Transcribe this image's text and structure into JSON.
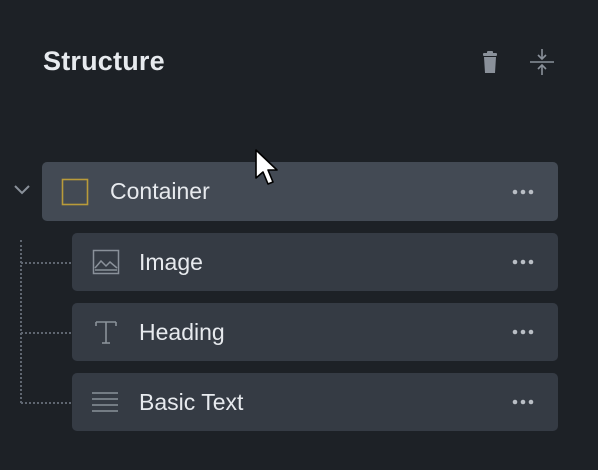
{
  "panel": {
    "title": "Structure",
    "actions": [
      {
        "name": "delete",
        "icon": "trash-icon"
      },
      {
        "name": "collapse-all",
        "icon": "collapse-vertical-icon"
      }
    ]
  },
  "tree": {
    "root": {
      "label": "Container",
      "icon": "container-square-icon",
      "expanded": true,
      "selected": true,
      "children": [
        {
          "label": "Image",
          "icon": "image-icon"
        },
        {
          "label": "Heading",
          "icon": "text-t-icon"
        },
        {
          "label": "Basic Text",
          "icon": "paragraph-lines-icon"
        }
      ]
    }
  },
  "colors": {
    "background": "#1d2126",
    "row": "#353b44",
    "row_selected": "#434a54",
    "container_icon": "#b99b3a",
    "text": "#e7eaee",
    "icon_muted": "#8a919a"
  }
}
